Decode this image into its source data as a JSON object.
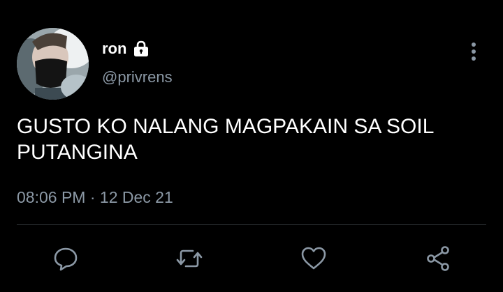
{
  "tweet": {
    "author": {
      "display_name": "ron",
      "handle": "@privrens",
      "protected_icon": "lock-icon",
      "avatar": "profile-photo"
    },
    "text_lines": [
      "GUSTO KO NALANG MAGPAKAIN SA SOIL",
      "PUTANGINA"
    ],
    "time": "08:06 PM",
    "separator": "·",
    "date": "12 Dec 21",
    "menu_icon": "more-vertical-icon",
    "actions": [
      {
        "name": "reply",
        "icon": "reply-icon"
      },
      {
        "name": "retweet",
        "icon": "retweet-icon"
      },
      {
        "name": "like",
        "icon": "heart-icon"
      },
      {
        "name": "share",
        "icon": "share-icon"
      }
    ]
  },
  "colors": {
    "background": "#000000",
    "primary_text": "#ffffff",
    "secondary_text": "#8b98a5",
    "divider": "#2f3336",
    "icon": "#8b98a5"
  }
}
